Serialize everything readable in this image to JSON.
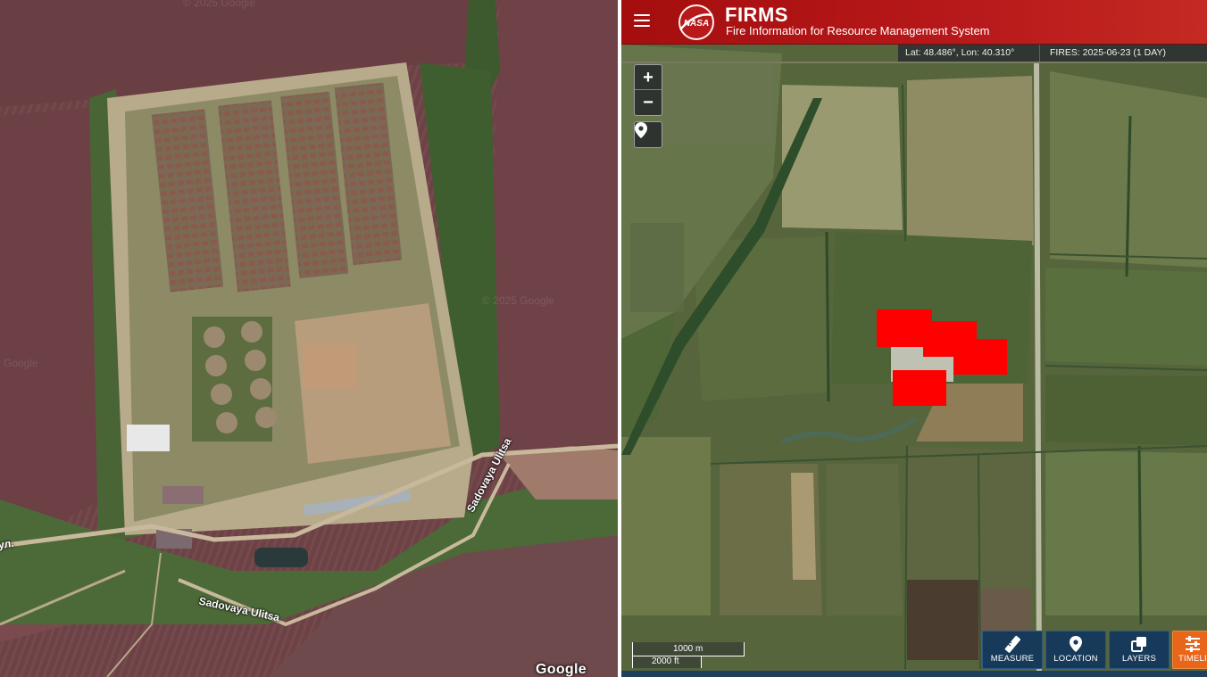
{
  "left_map": {
    "road_label_1": "Sadovaya Ulitsa",
    "road_label_2": "Sadovaya Ulitsa",
    "road_label_partial": "ул.",
    "watermarks": [
      "© 2025 Google",
      "© 2025 Google",
      "Google"
    ],
    "provider_logo": "Google"
  },
  "firms": {
    "menu_icon": "hamburger-menu-icon",
    "logo": "nasa-logo",
    "title": "FIRMS",
    "subtitle": "Fire Information for Resource Management System",
    "coordinates": "Lat: 48.486°, Lon: 40.310°",
    "fires_info": "FIRES: 2025-06-23 (1 DAY)",
    "zoom_in_label": "+",
    "zoom_out_label": "−",
    "location_pin_icon": "map-pin-icon",
    "scale_metric": "1000 m",
    "scale_imperial": "2000 ft",
    "tools": [
      {
        "label": "MEASURE",
        "icon": "ruler-icon"
      },
      {
        "label": "LOCATION",
        "icon": "map-pin-icon"
      },
      {
        "label": "LAYERS",
        "icon": "layers-icon"
      },
      {
        "label": "TIMELI",
        "icon": "sliders-icon"
      }
    ],
    "colors": {
      "header_red": "#b8191b",
      "fire_detection": "#ff0000",
      "tool_blue": "#173a5a",
      "timeline_orange": "#e8651a"
    }
  }
}
